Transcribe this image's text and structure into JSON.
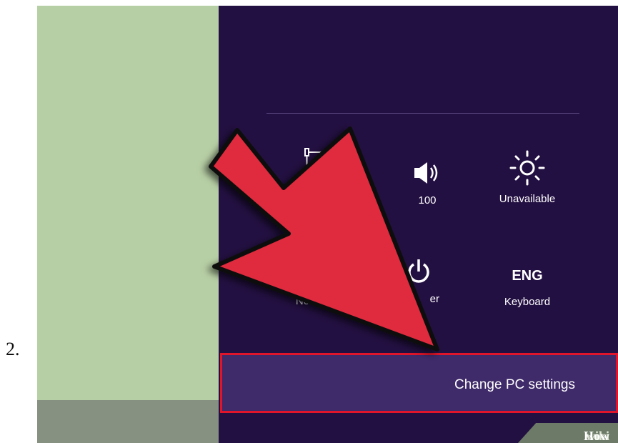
{
  "step_number": "2.",
  "charms": {
    "tiles": [
      {
        "icon": "network-icon",
        "label": ""
      },
      {
        "icon": "volume-icon",
        "label": "100"
      },
      {
        "icon": "brightness-icon",
        "label": "Unavailable"
      },
      {
        "icon": "notifications-icon",
        "label": "Notificat"
      },
      {
        "icon": "power-icon",
        "label": "er"
      },
      {
        "icon": "keyboard-icon",
        "label": "Keyboard",
        "glyph": "ENG"
      }
    ],
    "change_pc_settings": "Change PC settings"
  },
  "watermark": {
    "wiki": "wiki",
    "how": "How"
  },
  "colors": {
    "panel": "#231042",
    "highlight_border": "#e0142a",
    "arrow": "#e02a3c",
    "desktop": "#b7cfa5"
  }
}
